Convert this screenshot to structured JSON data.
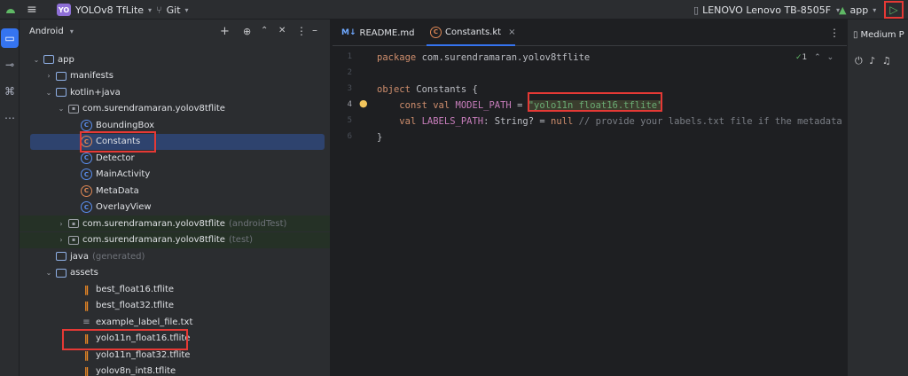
{
  "titlebar": {
    "project_badge": "YO",
    "project_name": "YOLOv8 TfLite",
    "vcs": "Git",
    "device": "LENOVO Lenovo TB-8505F",
    "run_config": "app",
    "menu_icon": "hamburger-icon",
    "run_icon": "play-icon"
  },
  "project_panel": {
    "view": "Android",
    "tree": [
      {
        "label": "app",
        "icon": "folder",
        "indent": 0,
        "chevron": "down"
      },
      {
        "label": "manifests",
        "icon": "folder",
        "indent": 1,
        "chevron": "right"
      },
      {
        "label": "kotlin+java",
        "icon": "folder",
        "indent": 1,
        "chevron": "down"
      },
      {
        "label": "com.surendramaran.yolov8tflite",
        "icon": "package",
        "indent": 2,
        "chevron": "down"
      },
      {
        "label": "BoundingBox",
        "icon": "kotlin-class",
        "indent": 3,
        "chevron": ""
      },
      {
        "label": "Constants",
        "icon": "kotlin-object",
        "indent": 3,
        "chevron": "",
        "selected": true
      },
      {
        "label": "Detector",
        "icon": "kotlin-class",
        "indent": 3,
        "chevron": ""
      },
      {
        "label": "MainActivity",
        "icon": "kotlin-class",
        "indent": 3,
        "chevron": ""
      },
      {
        "label": "MetaData",
        "icon": "kotlin-object",
        "indent": 3,
        "chevron": ""
      },
      {
        "label": "OverlayView",
        "icon": "kotlin-class",
        "indent": 3,
        "chevron": ""
      },
      {
        "label": "com.surendramaran.yolov8tflite",
        "hint": "(androidTest)",
        "icon": "package",
        "indent": 2,
        "chevron": "right",
        "green": true
      },
      {
        "label": "com.surendramaran.yolov8tflite",
        "hint": "(test)",
        "icon": "package",
        "indent": 2,
        "chevron": "right",
        "green": true
      },
      {
        "label": "java",
        "hint": "(generated)",
        "icon": "folder",
        "indent": 1,
        "chevron": ""
      },
      {
        "label": "assets",
        "icon": "folder",
        "indent": 1,
        "chevron": "down"
      },
      {
        "label": "best_float16.tflite",
        "icon": "tflite",
        "indent": 3,
        "chevron": ""
      },
      {
        "label": "best_float32.tflite",
        "icon": "tflite",
        "indent": 3,
        "chevron": ""
      },
      {
        "label": "example_label_file.txt",
        "icon": "text-file",
        "indent": 3,
        "chevron": ""
      },
      {
        "label": "yolo11n_float16.tflite",
        "icon": "tflite",
        "indent": 3,
        "chevron": ""
      },
      {
        "label": "yolo11n_float32.tflite",
        "icon": "tflite",
        "indent": 3,
        "chevron": ""
      },
      {
        "label": "yolov8n_int8.tflite",
        "icon": "tflite",
        "indent": 3,
        "chevron": ""
      }
    ]
  },
  "editor": {
    "tabs": [
      {
        "label": "README.md",
        "icon": "markdown",
        "active": false
      },
      {
        "label": "Constants.kt",
        "icon": "kotlin-object",
        "active": true
      }
    ],
    "inspection_count": "1",
    "current_line": 4,
    "lines": [
      {
        "n": "1",
        "text": "package com.surendramaran.yolov8tflite"
      },
      {
        "n": "2",
        "text": ""
      },
      {
        "n": "3",
        "text": "object Constants {"
      },
      {
        "n": "4",
        "text": "    const val MODEL_PATH = \"yolo11n_float16.tflite\""
      },
      {
        "n": "5",
        "text": "    val LABELS_PATH: String? = null // provide your labels.txt file if the metadata not present in the model"
      },
      {
        "n": "6",
        "text": "}"
      }
    ],
    "tokens": {
      "package_kw": "package",
      "package_name": " com.surendramaran.yolov8tflite",
      "object_kw": "object",
      "object_name": " Constants {",
      "const_kw": "const",
      "val_kw": "val",
      "model_path_name": "MODEL_PATH",
      "eq": " = ",
      "model_path_value": "\"yolo11n_float16.tflite\"",
      "labels_path_name": "LABELS_PATH",
      "labels_type": ": String? = ",
      "null_kw": "null",
      "comment": " // provide your labels.txt file if the metadata not present in the model",
      "close_brace": "}"
    }
  },
  "right_panel": {
    "label": "Medium P"
  },
  "colors": {
    "accent": "#3574f0",
    "highlight_box": "#e53935",
    "run_green": "#5fb865",
    "tflite_orange": "#f08a24"
  }
}
